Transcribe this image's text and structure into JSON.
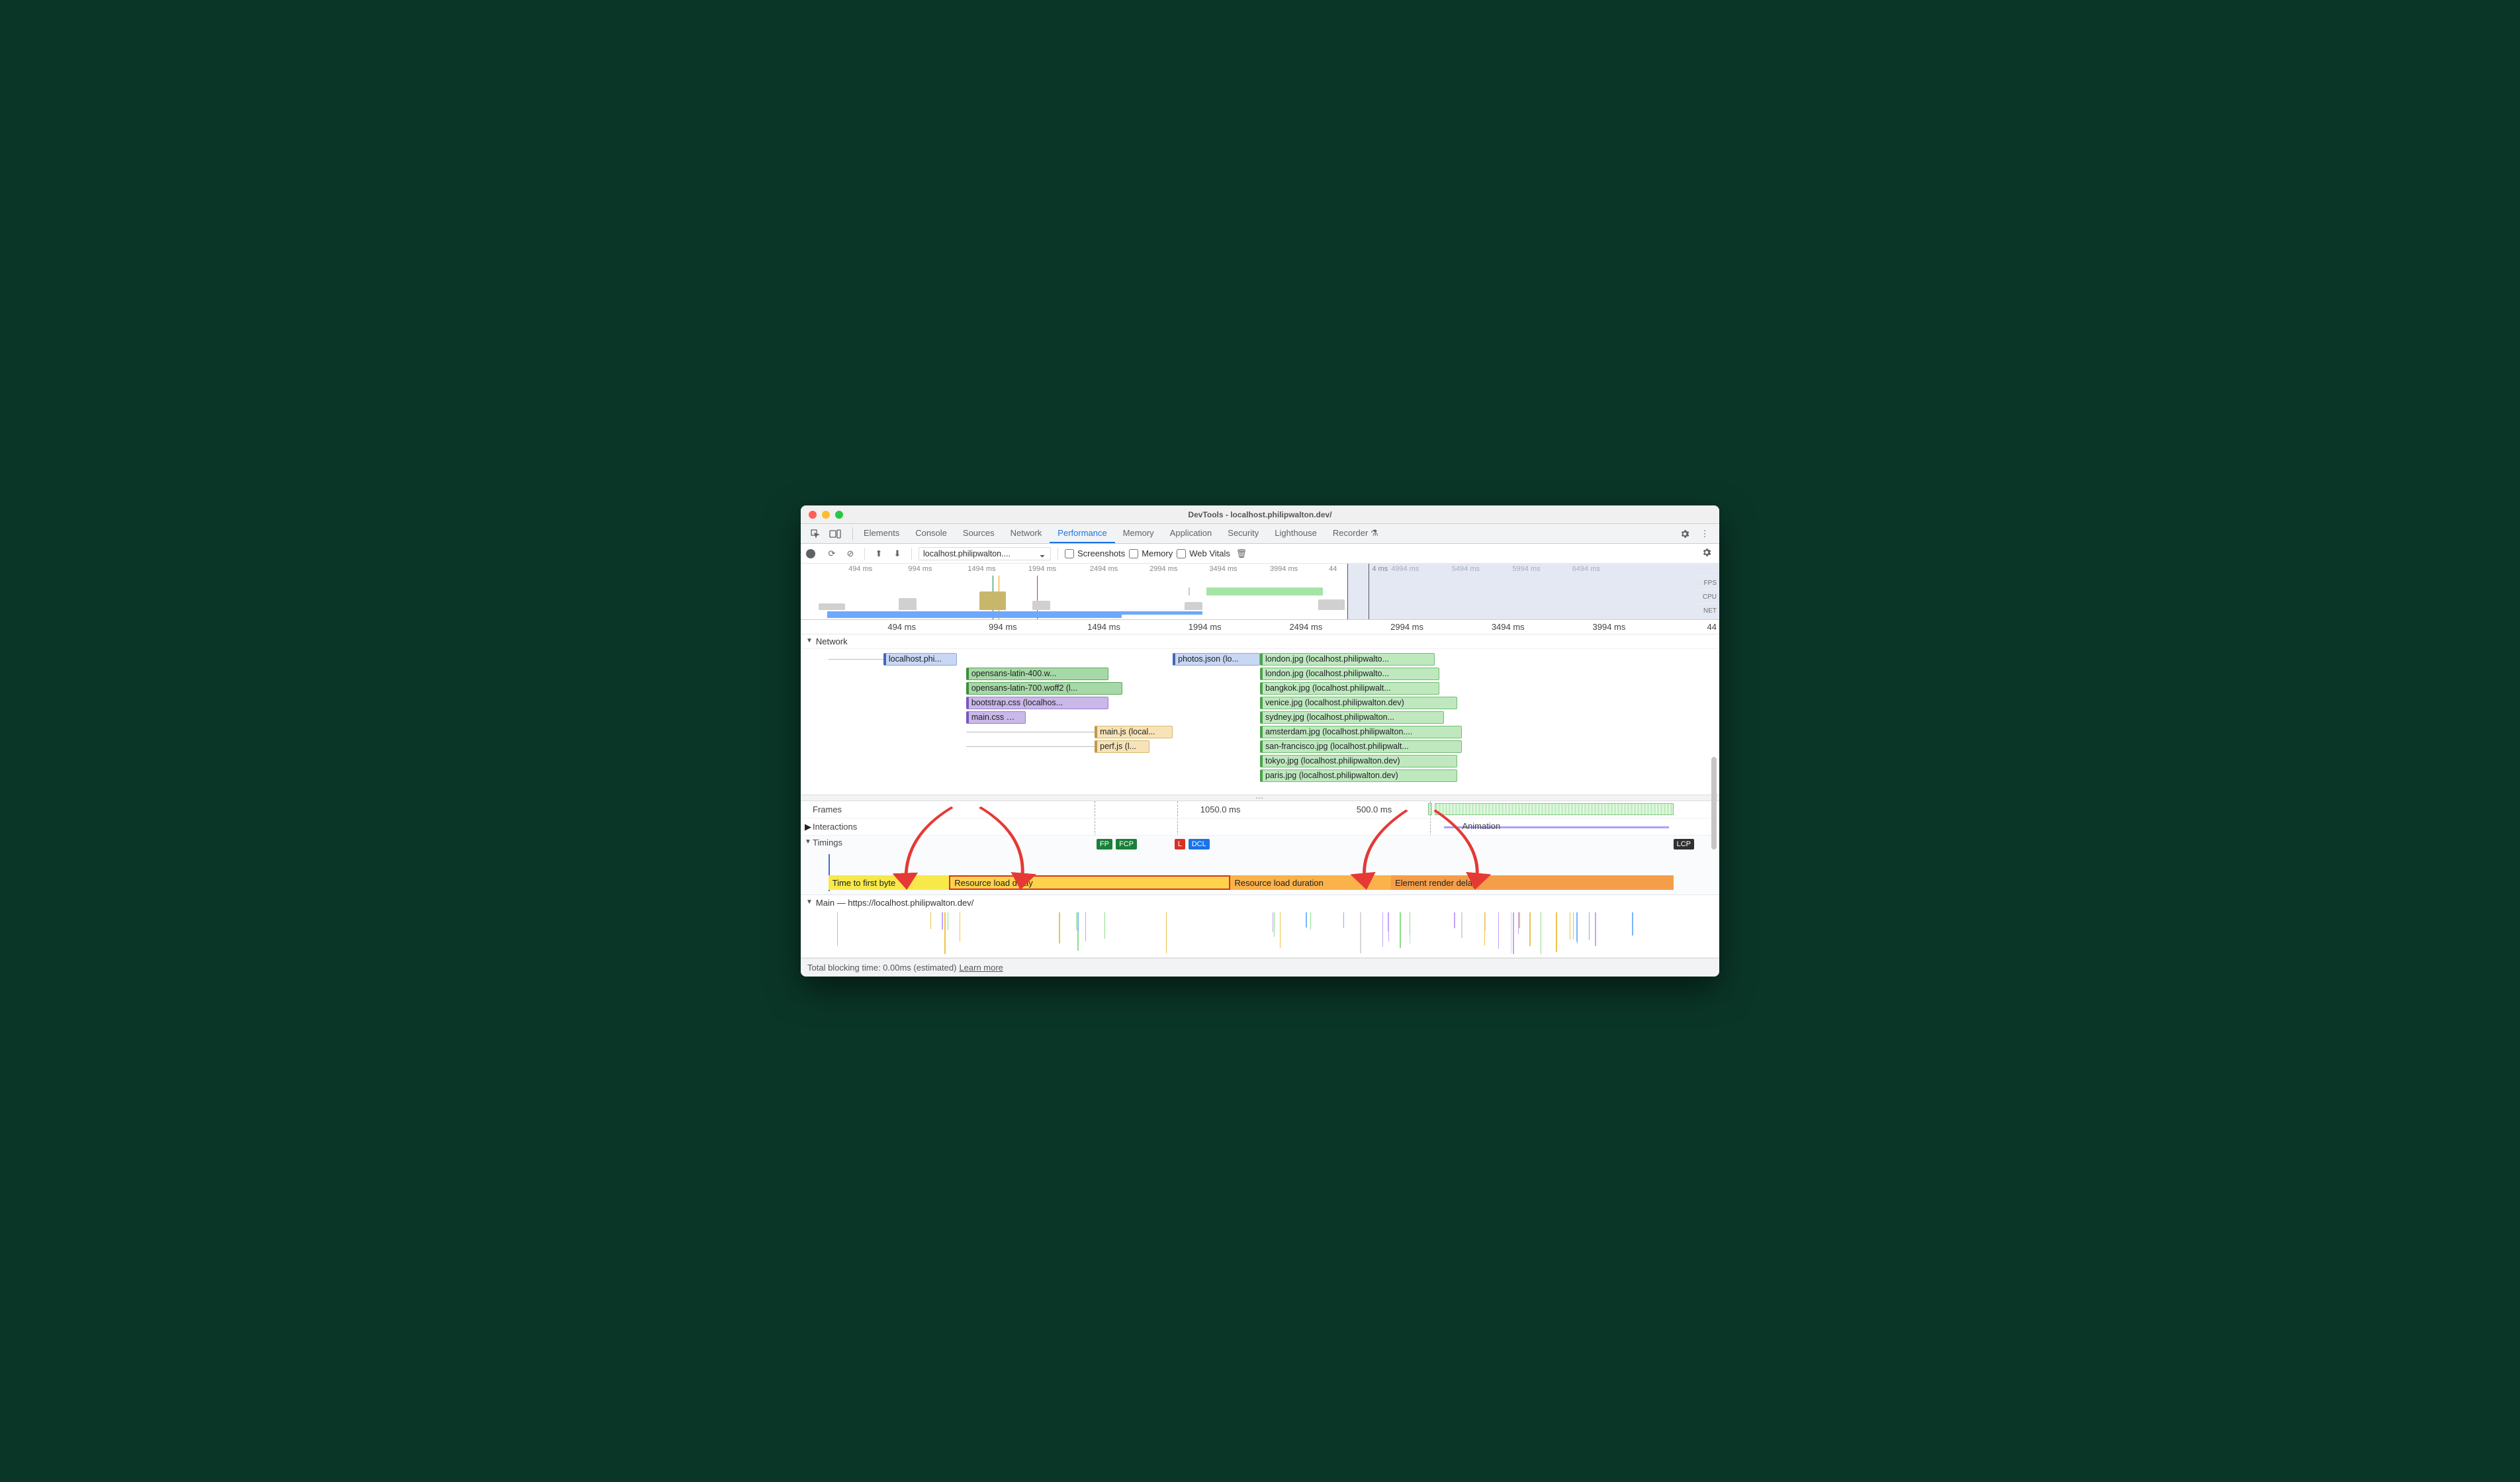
{
  "window": {
    "title": "DevTools - localhost.philipwalton.dev/"
  },
  "tabs": {
    "items": [
      "Elements",
      "Console",
      "Sources",
      "Network",
      "Performance",
      "Memory",
      "Application",
      "Security",
      "Lighthouse",
      "Recorder ⚗"
    ],
    "active": "Performance"
  },
  "toolbar": {
    "context": "localhost.philipwalton....",
    "cb_screenshots": "Screenshots",
    "cb_memory": "Memory",
    "cb_webvitals": "Web Vitals"
  },
  "overview": {
    "ticks": [
      {
        "label": "494 ms",
        "pct": 6.5
      },
      {
        "label": "994 ms",
        "pct": 13
      },
      {
        "label": "1494 ms",
        "pct": 19.7
      },
      {
        "label": "1994 ms",
        "pct": 26.3
      },
      {
        "label": "2494 ms",
        "pct": 33
      },
      {
        "label": "2994 ms",
        "pct": 39.5
      },
      {
        "label": "3494 ms",
        "pct": 46
      },
      {
        "label": "3994 ms",
        "pct": 52.6
      },
      {
        "label": "4994 ms",
        "pct": 65.8
      },
      {
        "label": "5494 ms",
        "pct": 72.4
      },
      {
        "label": "5994 ms",
        "pct": 79
      },
      {
        "label": "6494 ms",
        "pct": 85.5
      }
    ],
    "sticky_left": "44",
    "sticky_right": "4 ms",
    "lanes": [
      "FPS",
      "CPU",
      "NET"
    ]
  },
  "main_ruler": {
    "ticks": [
      {
        "label": "494 ms",
        "pct": 11
      },
      {
        "label": "994 ms",
        "pct": 22
      },
      {
        "label": "1494 ms",
        "pct": 33
      },
      {
        "label": "1994 ms",
        "pct": 44
      },
      {
        "label": "2494 ms",
        "pct": 55
      },
      {
        "label": "2994 ms",
        "pct": 66
      },
      {
        "label": "3494 ms",
        "pct": 77
      },
      {
        "label": "3994 ms",
        "pct": 88
      }
    ],
    "tail": "44"
  },
  "sections": {
    "network": "Network",
    "frames": "Frames",
    "interactions": "Interactions",
    "timings": "Timings",
    "main": "Main — https://localhost.philipwalton.dev/"
  },
  "network_items": [
    {
      "label": "localhost.phi...",
      "cls": "doc",
      "row": 0,
      "start": 9,
      "width": 8,
      "wait_start": 3,
      "wait_end": 9
    },
    {
      "label": "opensans-latin-400.w...",
      "cls": "font",
      "row": 1,
      "start": 18,
      "width": 15.5
    },
    {
      "label": "opensans-latin-700.woff2 (l...",
      "cls": "font",
      "row": 2,
      "start": 18,
      "width": 17
    },
    {
      "label": "bootstrap.css (localhos...",
      "cls": "css",
      "row": 3,
      "start": 18,
      "width": 15.5
    },
    {
      "label": "main.css …",
      "cls": "css",
      "row": 4,
      "start": 18,
      "width": 6.5
    },
    {
      "label": "main.js (local...",
      "cls": "js",
      "row": 5,
      "start": 32,
      "width": 8.5,
      "wait_start": 18,
      "wait_end": 32
    },
    {
      "label": "perf.js (l...",
      "cls": "js",
      "row": 6,
      "start": 32,
      "width": 6,
      "wait_start": 18,
      "wait_end": 32
    },
    {
      "label": "photos.json (lo...",
      "cls": "doc",
      "row": 0,
      "start": 40.5,
      "width": 9.5
    },
    {
      "label": "london.jpg (localhost.philipwalto...",
      "cls": "img",
      "row": 0,
      "start": 50,
      "width": 19
    },
    {
      "label": "london.jpg (localhost.philipwalto...",
      "cls": "img",
      "row": 1,
      "start": 50,
      "width": 19.5
    },
    {
      "label": "bangkok.jpg (localhost.philipwalt...",
      "cls": "img",
      "row": 2,
      "start": 50,
      "width": 19.5
    },
    {
      "label": "venice.jpg (localhost.philipwalton.dev)",
      "cls": "img",
      "row": 3,
      "start": 50,
      "width": 21.5
    },
    {
      "label": "sydney.jpg (localhost.philipwalton...",
      "cls": "img",
      "row": 4,
      "start": 50,
      "width": 20
    },
    {
      "label": "amsterdam.jpg (localhost.philipwalton....",
      "cls": "img",
      "row": 5,
      "start": 50,
      "width": 22
    },
    {
      "label": "san-francisco.jpg (localhost.philipwalt...",
      "cls": "img",
      "row": 6,
      "start": 50,
      "width": 22
    },
    {
      "label": "tokyo.jpg (localhost.philipwalton.dev)",
      "cls": "img",
      "row": 7,
      "start": 50,
      "width": 21.5
    },
    {
      "label": "paris.jpg (localhost.philipwalton.dev)",
      "cls": "img",
      "row": 8,
      "start": 50,
      "width": 21.5
    }
  ],
  "frames": {
    "f1": "1050.0 ms",
    "f2": "500.0 ms",
    "animation": "Animation"
  },
  "timings": {
    "markers": [
      {
        "label": "FP",
        "cls": "tm-green",
        "pct": 32.2
      },
      {
        "label": "FCP",
        "cls": "tm-green",
        "pct": 34.3
      },
      {
        "label": "L",
        "cls": "tm-red",
        "pct": 40.7
      },
      {
        "label": "DCL",
        "cls": "tm-blue",
        "pct": 42.2
      },
      {
        "label": "LCP",
        "cls": "tm-dark",
        "pct": 95
      }
    ],
    "breakdown": {
      "ttfb": "Time to first byte",
      "rld": "Resource load delay",
      "rdur": "Resource load duration",
      "erd": "Element render delay"
    }
  },
  "footer": {
    "text": "Total blocking time: 0.00ms (estimated)",
    "link": "Learn more"
  }
}
